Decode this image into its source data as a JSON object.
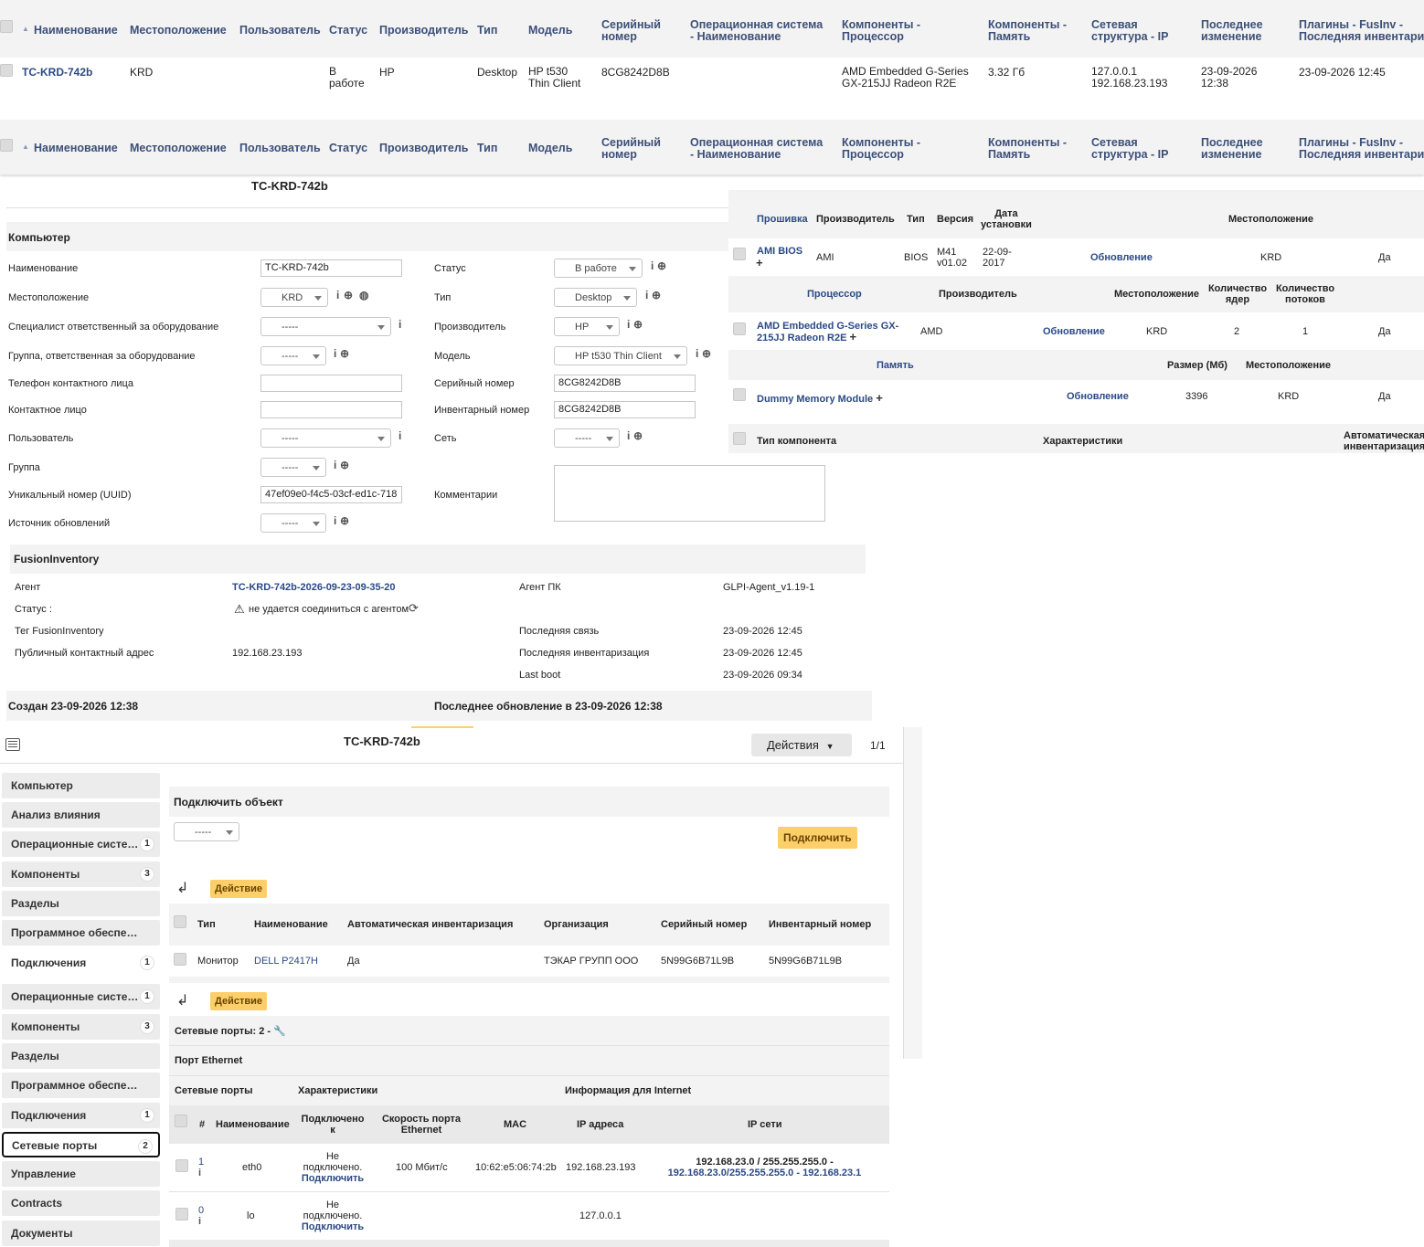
{
  "columns": {
    "name": "Наименование",
    "location": "Местоположение",
    "user": "Пользователь",
    "status": "Статус",
    "manufacturer": "Производитель",
    "type": "Тип",
    "model": "Модель",
    "serial_l1": "Серийный",
    "serial_l2": "номер",
    "os_l1": "Операционная система",
    "os_l2": "- Наименование",
    "cpu_l1": "Компоненты -",
    "cpu_l2": "Процессор",
    "mem_l1": "Компоненты -",
    "mem_l2": "Память",
    "net_l1": "Сетевая",
    "net_l2": "структура - IP",
    "mod_l1": "Последнее",
    "mod_l2": "изменение",
    "plug_l1": "Плагины - FusInv -",
    "plug_l2": "Последняя инвентари"
  },
  "list_row": {
    "name": "TC-KRD-742b",
    "location": "KRD",
    "status_l1": "В",
    "status_l2": "работе",
    "manufacturer": "HP",
    "type": "Desktop",
    "model_l1": "HP t530",
    "model_l2": "Thin Client",
    "serial": "8CG8242D8B",
    "cpu_l1": "AMD Embedded G-Series",
    "cpu_l2": "GX-215JJ Radeon R2E",
    "memory": "3.32 Гб",
    "ip_l1": "127.0.0.1",
    "ip_l2": "192.168.23.193",
    "modified_l1": "23-09-2026",
    "modified_l2": "12:38",
    "last_inventory": "23-09-2026 12:45"
  },
  "form": {
    "title": "TC-KRD-742b",
    "section": "Компьютер",
    "labels": {
      "name": "Наименование",
      "location": "Местоположение",
      "tech_person": "Специалист ответственный за оборудование",
      "tech_group": "Группа, ответственная за оборудование",
      "contact_phone": "Телефон контактного лица",
      "contact": "Контактное лицо",
      "user": "Пользователь",
      "group": "Группа",
      "uuid": "Уникальный номер (UUID)",
      "update_source": "Источник обновлений",
      "status": "Статус",
      "type": "Тип",
      "manufacturer": "Производитель",
      "model": "Модель",
      "serial": "Серийный номер",
      "inventory": "Инвентарный номер",
      "network": "Сеть",
      "comments": "Комментарии"
    },
    "values": {
      "name": "TC-KRD-742b",
      "location": "KRD",
      "empty": "-----",
      "uuid": "47ef09e0-f4c5-03cf-ed1c-718",
      "status": "В работе",
      "type": "Desktop",
      "manufacturer": "HP",
      "model": "HP t530 Thin Client",
      "serial": "8CG8242D8B",
      "inventory": "8CG8242D8B"
    }
  },
  "fusion": {
    "title": "FusionInventory",
    "agent_label": "Агент",
    "agent_value": "TC-KRD-742b-2026-09-23-09-35-20",
    "status_label": "Статус :",
    "status_value": "не удается соединиться с агентом",
    "tag_label": "Тег FusionInventory",
    "address_label": "Публичный контактный адрес",
    "address_value": "192.168.23.193",
    "agent_pc_label": "Агент ПК",
    "agent_pc_value": "GLPI-Agent_v1.19-1",
    "last_contact_label": "Последняя связь",
    "last_contact_value": "23-09-2026 12:45",
    "last_inv_label": "Последняя инвентаризация",
    "last_inv_value": "23-09-2026 12:45",
    "last_boot_label": "Last boot",
    "last_boot_value": "23-09-2026 09:34"
  },
  "footer": {
    "created": "Создан 23-09-2026 12:38",
    "updated": "Последнее обновление в 23-09-2026 12:38"
  },
  "components": {
    "fw_h": {
      "a": "Прошивка",
      "b": "Производитель",
      "c": "Тип",
      "d": "Версия",
      "e1": "Дата",
      "e2": "установки",
      "f": "Местоположение"
    },
    "fw_row": {
      "name": "AMI BIOS",
      "manufacturer": "AMI",
      "type": "BIOS",
      "ver1": "M41",
      "ver2": "v01.02",
      "date1": "22-09-",
      "date2": "2017",
      "update": "Обновление",
      "location": "KRD",
      "auto": "Да"
    },
    "cpu_h": {
      "a": "Процессор",
      "b": "Производитель",
      "c": "Местоположение",
      "d1": "Количество",
      "d2": "ядер",
      "e1": "Количество",
      "e2": "потоков"
    },
    "cpu_row": {
      "name1": "AMD Embedded G-Series GX-",
      "name2": "215JJ Radeon R2E",
      "manufacturer": "AMD",
      "update": "Обновление",
      "location": "KRD",
      "cores": "2",
      "threads": "1",
      "auto": "Да"
    },
    "mem_h": {
      "a": "Память",
      "b": "Размер (Мб)",
      "c": "Местоположение"
    },
    "mem_row": {
      "name": "Dummy Memory Module",
      "update": "Обновление",
      "size": "3396",
      "location": "KRD",
      "auto": "Да"
    },
    "type_h": {
      "a": "Тип компонента",
      "b": "Характеристики",
      "c1": "Автоматическая",
      "c2": "инвентаризация"
    }
  },
  "bottom": {
    "title": "TC-KRD-742b",
    "actions": "Действия",
    "pager": "1/1",
    "sidebar": [
      {
        "label": "Компьютер",
        "badge": ""
      },
      {
        "label": "Анализ влияния",
        "badge": ""
      },
      {
        "label": "Операционные систе…",
        "badge": "1"
      },
      {
        "label": "Компоненты",
        "badge": "3"
      },
      {
        "label": "Разделы",
        "badge": ""
      },
      {
        "label": "Программное обеспе…",
        "badge": ""
      },
      {
        "label": "Подключения",
        "badge": "1"
      },
      {
        "label": "Операционные систе…",
        "badge": "1"
      },
      {
        "label": "Компоненты",
        "badge": "3"
      },
      {
        "label": "Разделы",
        "badge": ""
      },
      {
        "label": "Программное обеспе…",
        "badge": ""
      },
      {
        "label": "Подключения",
        "badge": "1"
      },
      {
        "label": "Сетевые порты",
        "badge": "2"
      },
      {
        "label": "Управление",
        "badge": ""
      },
      {
        "label": "Contracts",
        "badge": ""
      },
      {
        "label": "Документы",
        "badge": ""
      }
    ],
    "connect_title": "Подключить объект",
    "connect_select": "-----",
    "connect_btn": "Подключить",
    "action_btn": "Действие",
    "conn_h": {
      "type": "Тип",
      "name": "Наименование",
      "auto": "Автоматическая инвентаризация",
      "org": "Организация",
      "serial": "Серийный номер",
      "inv": "Инвентарный номер"
    },
    "conn_row": {
      "type": "Монитор",
      "name": "DELL P2417H",
      "auto": "Да",
      "org": "ТЭКАР ГРУПП ООО",
      "serial": "5N99G6B71L9B",
      "inv": "5N99G6B71L9B"
    },
    "ports_title": "Сетевые порты: 2 -",
    "eth_title": "Порт Ethernet",
    "ports_h": {
      "ports": "Сетевые порты",
      "chars": "Характеристики",
      "inet": "Информация для Internet"
    },
    "ports_cols": {
      "num": "#",
      "name": "Наименование",
      "conn1": "Подключено",
      "conn2": "к",
      "speed1": "Скорость порта",
      "speed2": "Ethernet",
      "mac": "MAC",
      "ip": "IP адреса",
      "net": "IP сети"
    },
    "port1": {
      "num": "1",
      "name": "eth0",
      "c1": "Не",
      "c2": "подключено.",
      "c3": "Подключить",
      "speed": "100 Мбит/с",
      "mac": "10:62:e5:06:74:2b",
      "ip": "192.168.23.193",
      "net1": "192.168.23.0 / 255.255.255.0 -",
      "net2": "192.168.23.0/255.255.255.0 - 192.168.23.1"
    },
    "port2": {
      "num": "0",
      "name": "lo",
      "c1": "Не",
      "c2": "подключено.",
      "c3": "Подключить",
      "ip": "127.0.0.1"
    }
  }
}
